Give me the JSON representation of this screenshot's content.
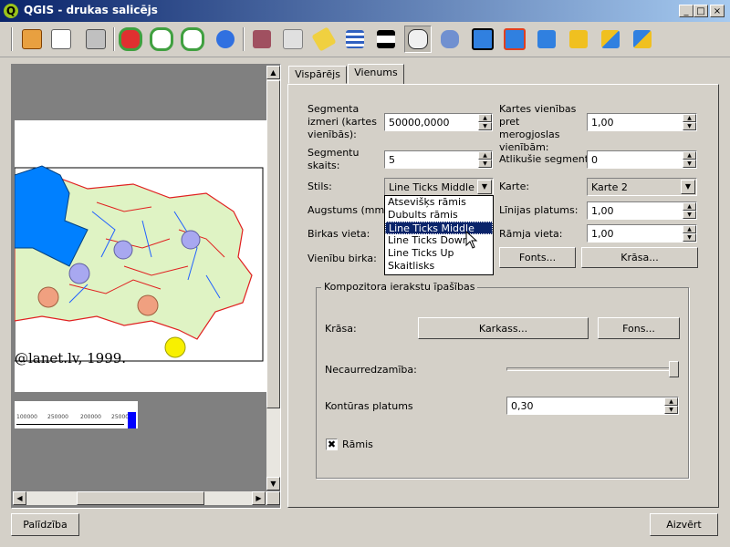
{
  "window": {
    "title": "QGIS - drukas salicējs",
    "logo_letter": "Q",
    "btn_minimize": "_",
    "btn_maximize": "□",
    "btn_close": "×"
  },
  "toolbar": {
    "icons": [
      "add-map-icon",
      "export-svg-icon",
      "print-icon",
      "zoom-full-icon",
      "zoom-in-icon",
      "zoom-out-icon",
      "refresh-icon",
      "add-vector-icon",
      "add-image-icon",
      "add-label-icon",
      "add-legend-icon",
      "add-scalebar-icon",
      "select-move-icon",
      "move-content-icon",
      "group-icon",
      "ungroup-icon",
      "raise-icon",
      "lower-icon",
      "bring-top-icon",
      "send-bottom-icon"
    ]
  },
  "map": {
    "credit_text": "@lanet.lv, 1999.",
    "scale_ticks": [
      "100000",
      "250000",
      "200000",
      "250000"
    ]
  },
  "tabs": [
    {
      "label": "Vispārējs"
    },
    {
      "label": "Vienums"
    }
  ],
  "form": {
    "segment_size_label": "Segmenta izmeri (kartes vienībās):",
    "segment_size_value": "50000,0000",
    "map_units_label": "Kartes vienības pret merogjoslas vienībām:",
    "map_units_value": "1,00",
    "segments_label": "Segmentu skaits:",
    "segments_value": "5",
    "left_segments_label": "Atlikušie segmenti:",
    "left_segments_value": "0",
    "style_label": "Stils:",
    "style_value": "Line Ticks Middle",
    "map_label": "Karte:",
    "map_value": "Karte 2",
    "height_label": "Augstums (mm):",
    "line_width_label": "Līnijas platums:",
    "line_width_value": "1,00",
    "label_space_label": "Birkas vieta:",
    "frame_space_label": "Rāmja vieta:",
    "frame_space_value": "1,00",
    "unit_label_label": "Vienību birka:",
    "font_button": "Fonts...",
    "color_button": "Krāsa...",
    "style_options": [
      "Atsevišķs rāmis",
      "Dubults rāmis",
      "Line Ticks Middle",
      "Line Ticks Down",
      "Line Ticks Up",
      "Skaitlisks"
    ],
    "style_selected_index": 2
  },
  "group": {
    "title": "Kompozitora ierakstu īpašības",
    "color_label": "Krāsa:",
    "frame_button": "Karkass...",
    "background_button": "Fons...",
    "opacity_label": "Necaurredzamība:",
    "opacity_value": 1.0,
    "outline_label": "Kontūras platums",
    "outline_value": "0,30",
    "frame_checkbox_label": "Rāmis",
    "frame_checked": true
  },
  "footer": {
    "help_button": "Palīdzība",
    "close_button": "Aizvērt"
  },
  "colors": {
    "accent": "#0a246a",
    "lake": "#0080ff",
    "land": "#dff3c4",
    "border": "#e02020"
  }
}
